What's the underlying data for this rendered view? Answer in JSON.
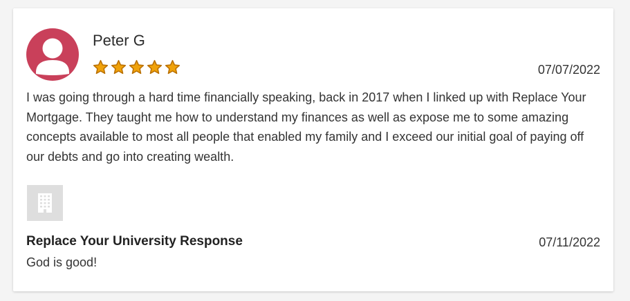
{
  "review": {
    "reviewer_name": "Peter G",
    "rating": 5,
    "max_rating": 5,
    "date": "07/07/2022",
    "text": "I was going through a hard time financially speaking, back in 2017 when I linked up with Replace Your Mortgage. They taught me how to understand my finances as well as expose me to some amazing concepts available to most all people that enabled my family and I exceed our initial goal of paying off our debts and go into creating wealth.",
    "avatar_icon": "user-silhouette-icon",
    "avatar_color": "#c9405a",
    "star_color": "#f0a20a"
  },
  "response": {
    "logo_icon": "building-icon",
    "title": "Replace Your University Response",
    "date": "07/11/2022",
    "text": "God is good!"
  }
}
